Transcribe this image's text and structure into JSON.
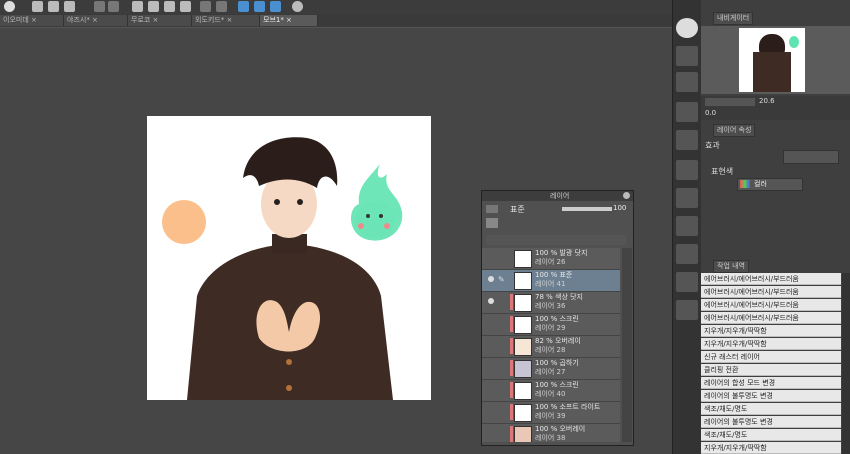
{
  "tabs": [
    "이오미데 ×",
    "야즈시* ×",
    "무로코 ×",
    "외도키드* ×",
    "모브1* ×"
  ],
  "navigator": {
    "title": "내비게이터",
    "zoom": "20.6",
    "rotation": "0.0"
  },
  "layer_property": {
    "title": "레이어 속성",
    "effect_label": "효과",
    "expression_label": "표현색",
    "expression_value": "컬러"
  },
  "layer_panel": {
    "title": "레이어",
    "blend_mode": "표준",
    "opacity": "100",
    "layers": [
      {
        "line1": "100 % 발광 닷지",
        "line2": "레이어 26",
        "visible": false,
        "selected": false,
        "thumb": "#ffffff",
        "tag": false
      },
      {
        "line1": "100 % 표준",
        "line2": "레이어 41",
        "visible": true,
        "selected": true,
        "thumb": "#ffffff",
        "tag": false
      },
      {
        "line1": "78 % 색상 닷지",
        "line2": "레이어 36",
        "visible": true,
        "selected": false,
        "thumb": "#ffffff",
        "tag": true
      },
      {
        "line1": "100 % 스크린",
        "line2": "레이어 29",
        "visible": false,
        "selected": false,
        "thumb": "#ffffff",
        "tag": true
      },
      {
        "line1": "82 % 오버레이",
        "line2": "레이어 28",
        "visible": false,
        "selected": false,
        "thumb": "#f5e6d6",
        "tag": true
      },
      {
        "line1": "100 % 곱하기",
        "line2": "레이어 27",
        "visible": false,
        "selected": false,
        "thumb": "#c9c4d4",
        "tag": true
      },
      {
        "line1": "100 % 스크린",
        "line2": "레이어 40",
        "visible": false,
        "selected": false,
        "thumb": "#ffffff",
        "tag": true
      },
      {
        "line1": "100 % 소프트 라이트",
        "line2": "레이어 39",
        "visible": false,
        "selected": false,
        "thumb": "#ffffff",
        "tag": true
      },
      {
        "line1": "100 % 오버레이",
        "line2": "레이어 38",
        "visible": false,
        "selected": false,
        "thumb": "#e9c8b8",
        "tag": true
      }
    ]
  },
  "history": {
    "title": "작업 내역",
    "items": [
      "에어브러시/에어브러시/부드러움",
      "에어브러시/에어브러시/부드러움",
      "에어브러시/에어브러시/부드러움",
      "에어브러시/에어브러시/부드러움",
      "지우개/지우개/딱딱함",
      "지우개/지우개/딱딱함",
      "신규 래스터 레이어",
      "클리핑 전환",
      "레이어의 합성 모드 변경",
      "레이어의 불투명도 변경",
      "색조/채도/명도",
      "레이어의 불투명도 변경",
      "색조/채도/명도",
      "지우개/지우개/딱딱함"
    ]
  },
  "colors": {
    "accent": "#e05050",
    "selected_layer": "#6c8091",
    "peach_circle": "#fbbf8c",
    "ghost_green": "#4ad9a6"
  }
}
